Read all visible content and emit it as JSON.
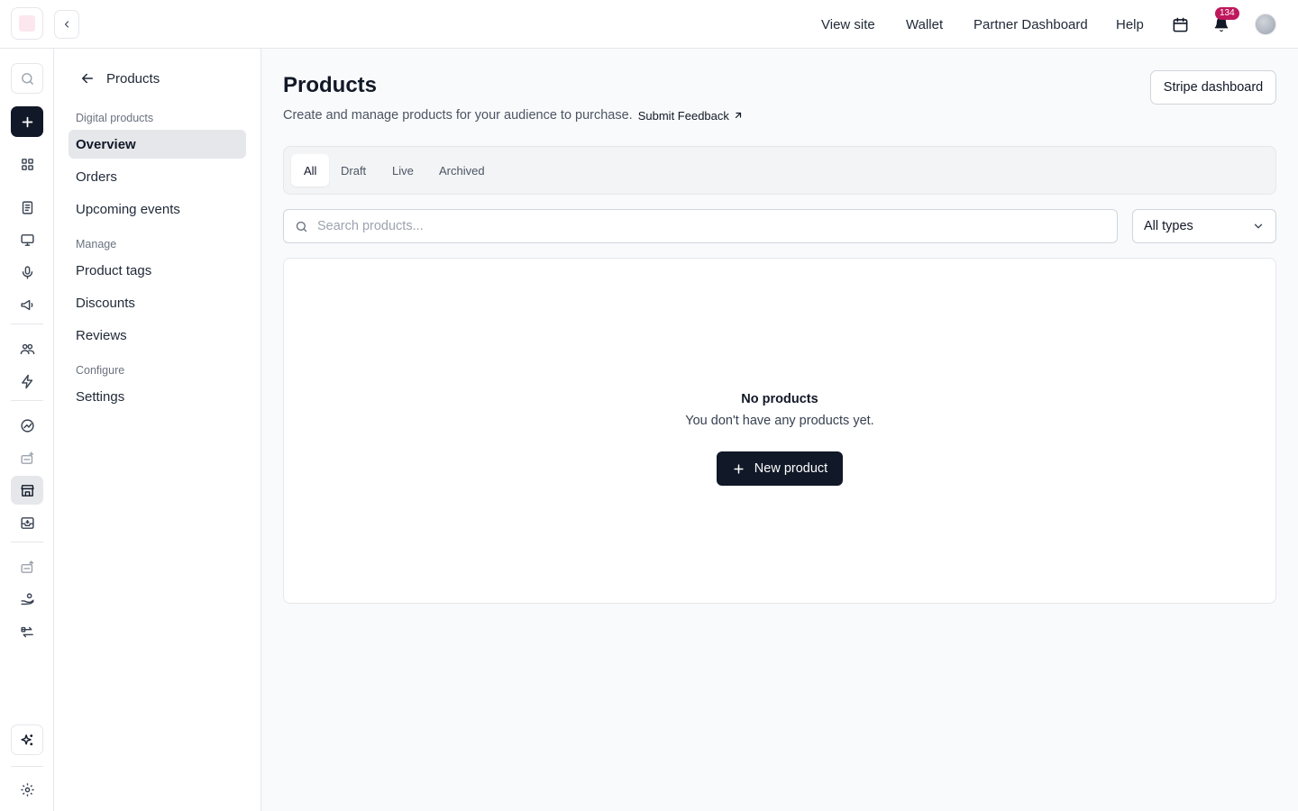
{
  "topbar": {
    "nav": [
      "View site",
      "Wallet",
      "Partner Dashboard",
      "Help"
    ],
    "notification_count": "134",
    "icons": [
      "chevron-left-icon",
      "calendar-icon",
      "bell-icon"
    ]
  },
  "rail": {
    "icons": [
      "search-icon",
      "plus-icon",
      "grid-icon",
      "newsletter-icon",
      "monitor-icon",
      "microphone-icon",
      "megaphone-icon",
      "users-icon",
      "lightning-icon",
      "growth-icon",
      "sponsor-icon",
      "store-icon",
      "inbox-icon",
      "ads-icon",
      "hand-coin-icon",
      "swap-icon",
      "sparkle-icon",
      "gear-icon"
    ],
    "active": "store-icon"
  },
  "sidebar": {
    "back_label": "Products",
    "sections": [
      {
        "title": "Digital products",
        "items": [
          "Overview",
          "Orders",
          "Upcoming events"
        ]
      },
      {
        "title": "Manage",
        "items": [
          "Product tags",
          "Discounts",
          "Reviews"
        ]
      },
      {
        "title": "Configure",
        "items": [
          "Settings"
        ]
      }
    ],
    "active_item": "Overview"
  },
  "main": {
    "title": "Products",
    "subtitle": "Create and manage products for your audience to purchase.",
    "feedback_label": "Submit Feedback",
    "stripe_button": "Stripe dashboard",
    "tabs": [
      "All",
      "Draft",
      "Live",
      "Archived"
    ],
    "active_tab": "All",
    "search_placeholder": "Search products...",
    "type_filter": "All types",
    "empty_title": "No products",
    "empty_desc": "You don't have any products yet.",
    "new_button": "New product"
  },
  "colors": {
    "primary": "#111827",
    "badge": "#be185d",
    "border": "#e5e7eb",
    "active_bg": "#e5e7eb"
  }
}
